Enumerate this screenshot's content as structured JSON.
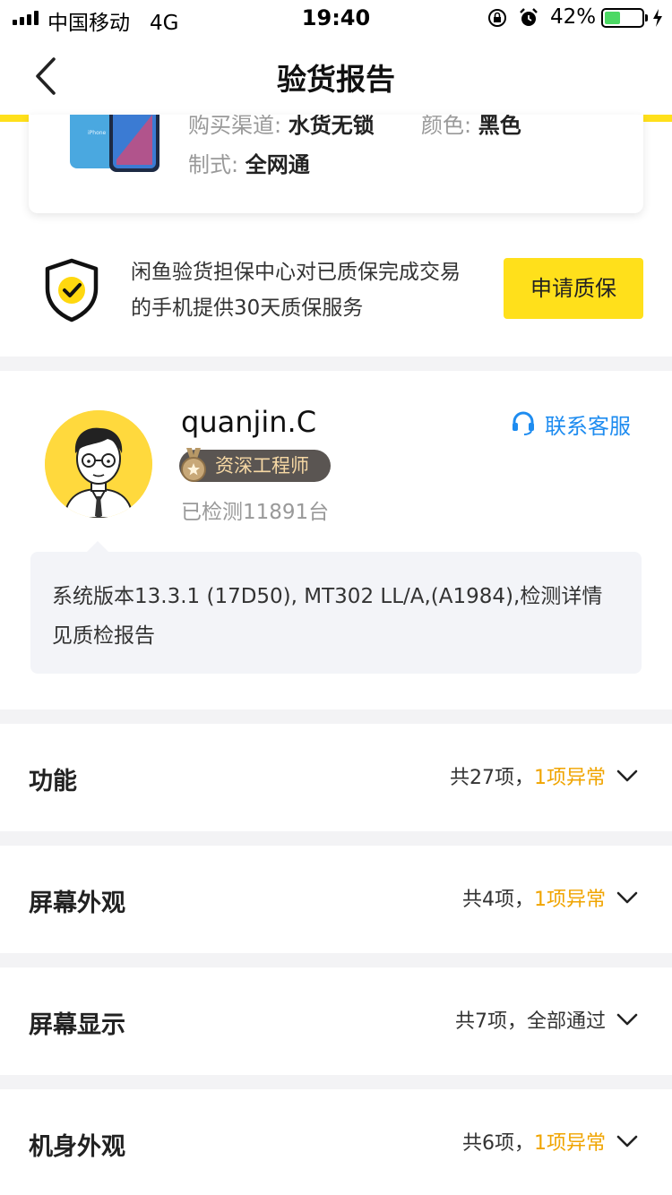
{
  "status_bar": {
    "carrier": "中国移动",
    "network": "4G",
    "time": "19:40",
    "battery_percent": "42%",
    "battery_level": 0.42,
    "battery_color": "#4cd964"
  },
  "nav": {
    "title": "验货报告",
    "back_icon": "chevron-left-icon"
  },
  "product": {
    "purchase_channel_label": "购买渠道:",
    "purchase_channel_value": "水货无锁",
    "color_label": "颜色:",
    "color_value": "黑色",
    "network_label": "制式:",
    "network_value": "全网通",
    "image_icon": "iphone-xr-image"
  },
  "guarantee": {
    "text": "闲鱼验货担保中心对已质保完成交易的手机提供30天质保服务",
    "button_label": "申请质保",
    "icon": "shield-check-icon"
  },
  "inspector": {
    "name": "quanjin.C",
    "title": "资深工程师",
    "inspected_count": "已检测11891台",
    "support_label": "联系客服",
    "version_text": "系统版本13.3.1 (17D50), MT302 LL/A,(A1984),检测详情见质检报告"
  },
  "sections": [
    {
      "title": "功能",
      "summary": "共27项，",
      "status": "1项异常",
      "abnormal": true
    },
    {
      "title": "屏幕外观",
      "summary": "共4项，",
      "status": "1项异常",
      "abnormal": true
    },
    {
      "title": "屏幕显示",
      "summary": "共7项，",
      "status": "全部通过",
      "abnormal": false
    },
    {
      "title": "机身外观",
      "summary": "共6项，",
      "status": "1项异常",
      "abnormal": true
    }
  ],
  "colors": {
    "accent_yellow": "#ffe01b",
    "abnormal_orange": "#f0a400",
    "link_blue": "#1e8cf0"
  }
}
